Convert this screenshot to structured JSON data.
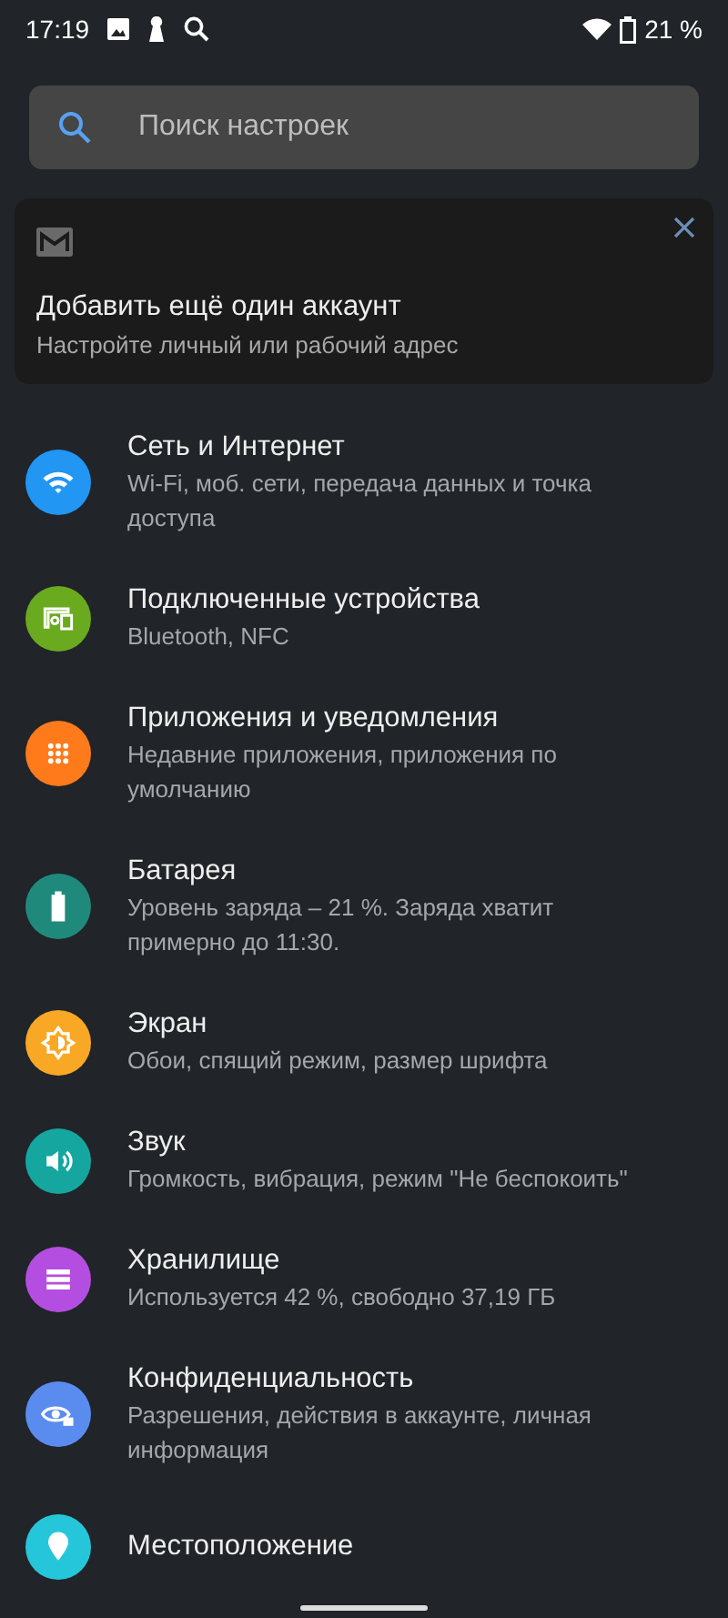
{
  "status_bar": {
    "time": "17:19",
    "battery": "21 %"
  },
  "search": {
    "placeholder": "Поиск настроек"
  },
  "suggestion_card": {
    "title": "Добавить ещё один аккаунт",
    "subtitle": "Настройте личный или рабочий адрес"
  },
  "items": [
    {
      "title": "Сеть и Интернет",
      "subtitle": "Wi-Fi, моб. сети, передача данных и точка доступа",
      "kind": "wifi",
      "color": "#2196f3"
    },
    {
      "title": "Подключенные устройства",
      "subtitle": "Bluetooth, NFC",
      "kind": "devices",
      "color": "#6aaa1e"
    },
    {
      "title": "Приложения и уведомления",
      "subtitle": "Недавние приложения, приложения по умолчанию",
      "kind": "apps",
      "color": "#ff7a1a"
    },
    {
      "title": "Батарея",
      "subtitle": "Уровень заряда – 21 %. Заряда хватит примерно до 11:30.",
      "kind": "battery",
      "color": "#1f8a7c"
    },
    {
      "title": "Экран",
      "subtitle": "Обои, спящий режим, размер шрифта",
      "kind": "display",
      "color": "#f9a825"
    },
    {
      "title": "Звук",
      "subtitle": "Громкость, вибрация, режим \"Не беспокоить\"",
      "kind": "sound",
      "color": "#15a6a0"
    },
    {
      "title": "Хранилище",
      "subtitle": "Используется 42 %, свободно 37,19 ГБ",
      "kind": "storage",
      "color": "#b44ee0"
    },
    {
      "title": "Конфиденциальность",
      "subtitle": "Разрешения, действия в аккаунте, личная информация",
      "kind": "privacy",
      "color": "#5a8cf0"
    },
    {
      "title": "Местоположение",
      "kind": "location",
      "color": "#26c6da"
    }
  ]
}
